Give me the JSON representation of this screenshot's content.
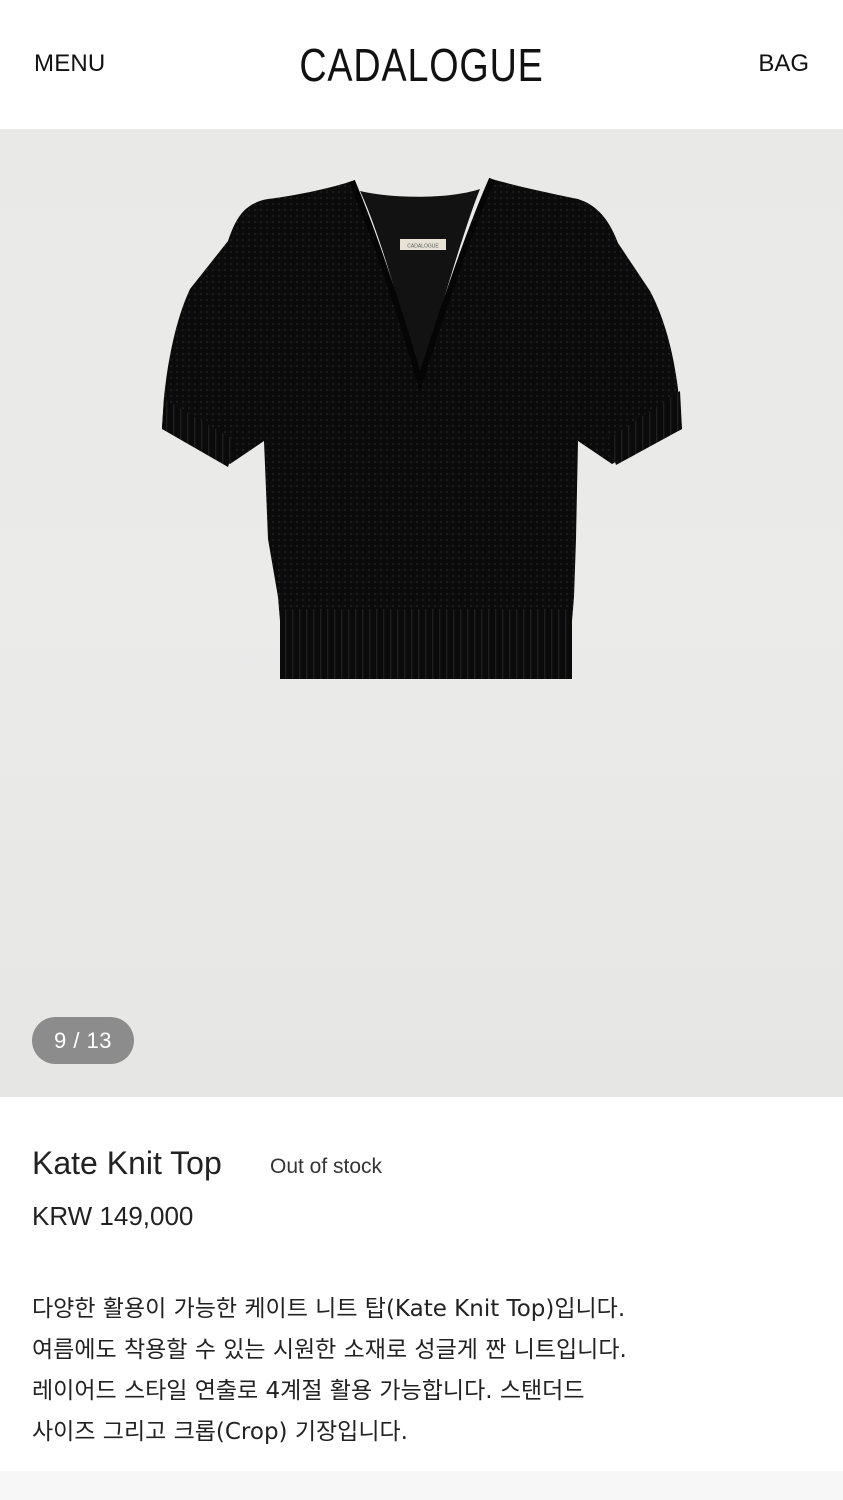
{
  "header": {
    "menu_label": "MENU",
    "logo": "CADALOGUE",
    "bag_label": "BAG"
  },
  "gallery": {
    "counter": "9 / 13",
    "product_label_text": "CADALOGUE",
    "background_color": "#eaeae8"
  },
  "product": {
    "name": "Kate Knit Top",
    "stock_status": "Out of stock",
    "price": "KRW 149,000",
    "description_lines": [
      "다양한 활용이 가능한 케이트 니트 탑(Kate Knit Top)입니다.",
      "여름에도 착용할 수 있는 시원한 소재로 성글게 짠 니트입니다.",
      "레이어드 스타일 연출로 4계절 활용 가능합니다. 스탠더드",
      "사이즈 그리고 크롭(Crop) 기장입니다."
    ]
  }
}
